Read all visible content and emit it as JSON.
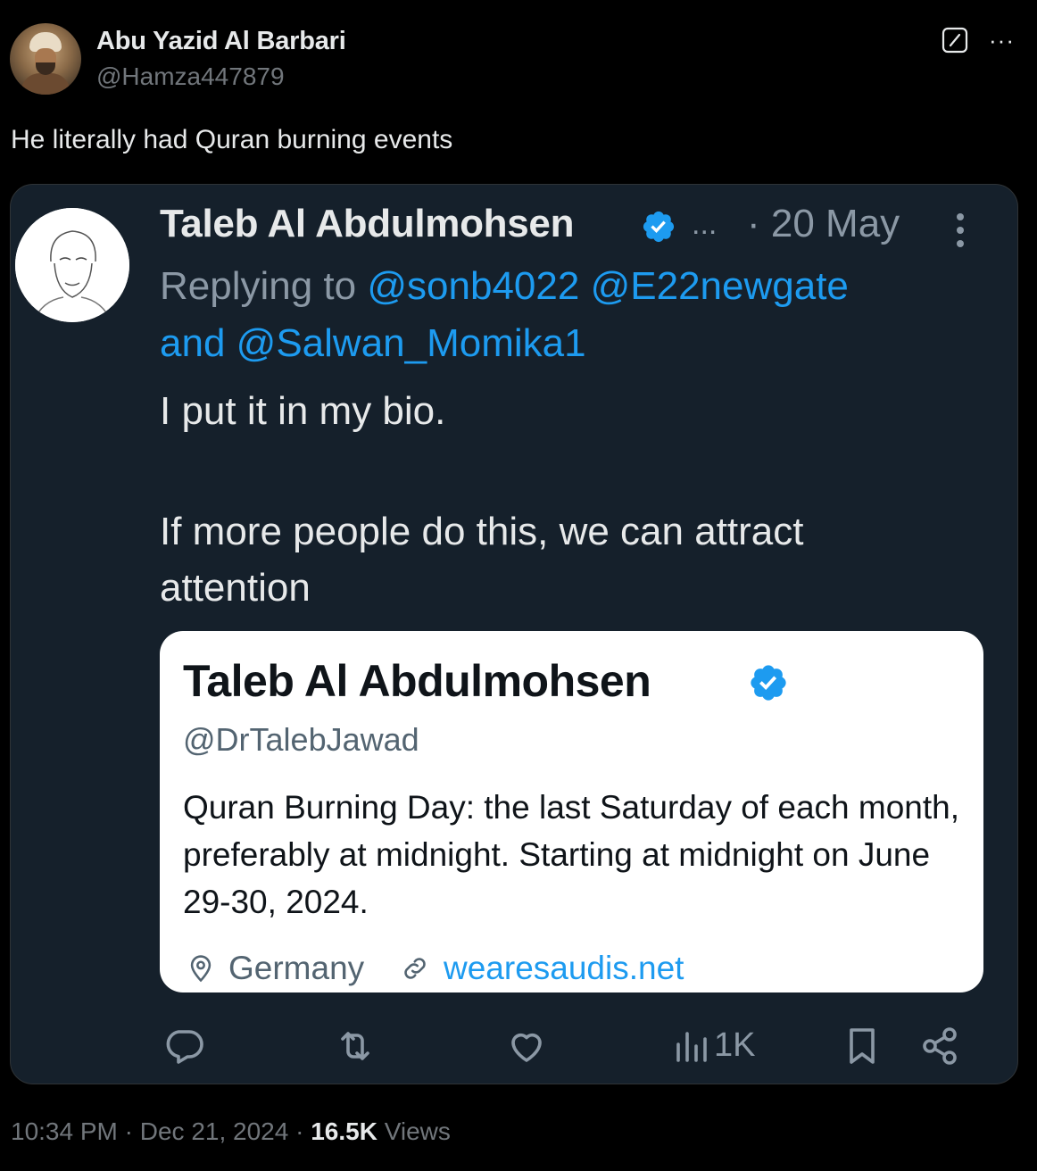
{
  "author": {
    "name": "Abu Yazid Al Barbari",
    "handle": "@Hamza447879"
  },
  "tweet": {
    "text": "He literally had Quran burning events",
    "time": "10:34 PM",
    "date": "Dec 21, 2024",
    "views_count": "16.5K",
    "views_label": "Views",
    "sep": "·"
  },
  "quoted": {
    "name": "Taleb Al Abdulmohsen",
    "ellipsis": "...",
    "date": "· 20 May",
    "replying_prefix": "Replying to",
    "mention1": "@sonb4022",
    "mention2": "@E22newgate",
    "mention_and": "and",
    "mention3": "@Salwan_Momika1",
    "body1": "I put it in my bio.",
    "body2": "If more people do this, we can attract attention",
    "views": "1K"
  },
  "bio": {
    "name": "Taleb Al Abdulmohsen",
    "handle": "@DrTalebJawad",
    "text": "Quran Burning Day: the last Saturday of each month, preferably at midnight.  Starting at midnight on June 29-30, 2024.",
    "location": "Germany",
    "website": "wearesaudis.net"
  },
  "icons": [
    "grok-icon",
    "more-icon",
    "verified-badge-icon",
    "kebab-icon",
    "reply-icon",
    "retweet-icon",
    "like-icon",
    "views-icon",
    "bookmark-icon",
    "share-icon",
    "location-icon",
    "link-icon"
  ],
  "colors": {
    "background": "#000000",
    "card": "#15202b",
    "accent": "#1d9bf0",
    "muted": "#71767b"
  }
}
